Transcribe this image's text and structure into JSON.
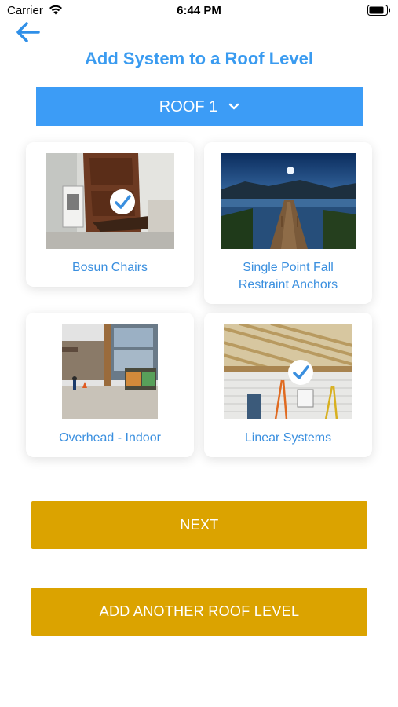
{
  "status": {
    "carrier": "Carrier",
    "time": "6:44 PM"
  },
  "header": {
    "title": "Add System to a Roof Level"
  },
  "roof_selector": {
    "value": "ROOF 1"
  },
  "systems": [
    {
      "label": "Bosun Chairs",
      "selected": true
    },
    {
      "label": "Single Point Fall Restraint Anchors",
      "selected": false
    },
    {
      "label": "Overhead - Indoor",
      "selected": false
    },
    {
      "label": "Linear Systems",
      "selected": true
    }
  ],
  "actions": {
    "next_label": "NEXT",
    "add_roof_label": "ADD ANOTHER ROOF LEVEL"
  },
  "colors": {
    "accent": "#3c9cf6",
    "title": "#3a9bf0",
    "button": "#dba300"
  }
}
